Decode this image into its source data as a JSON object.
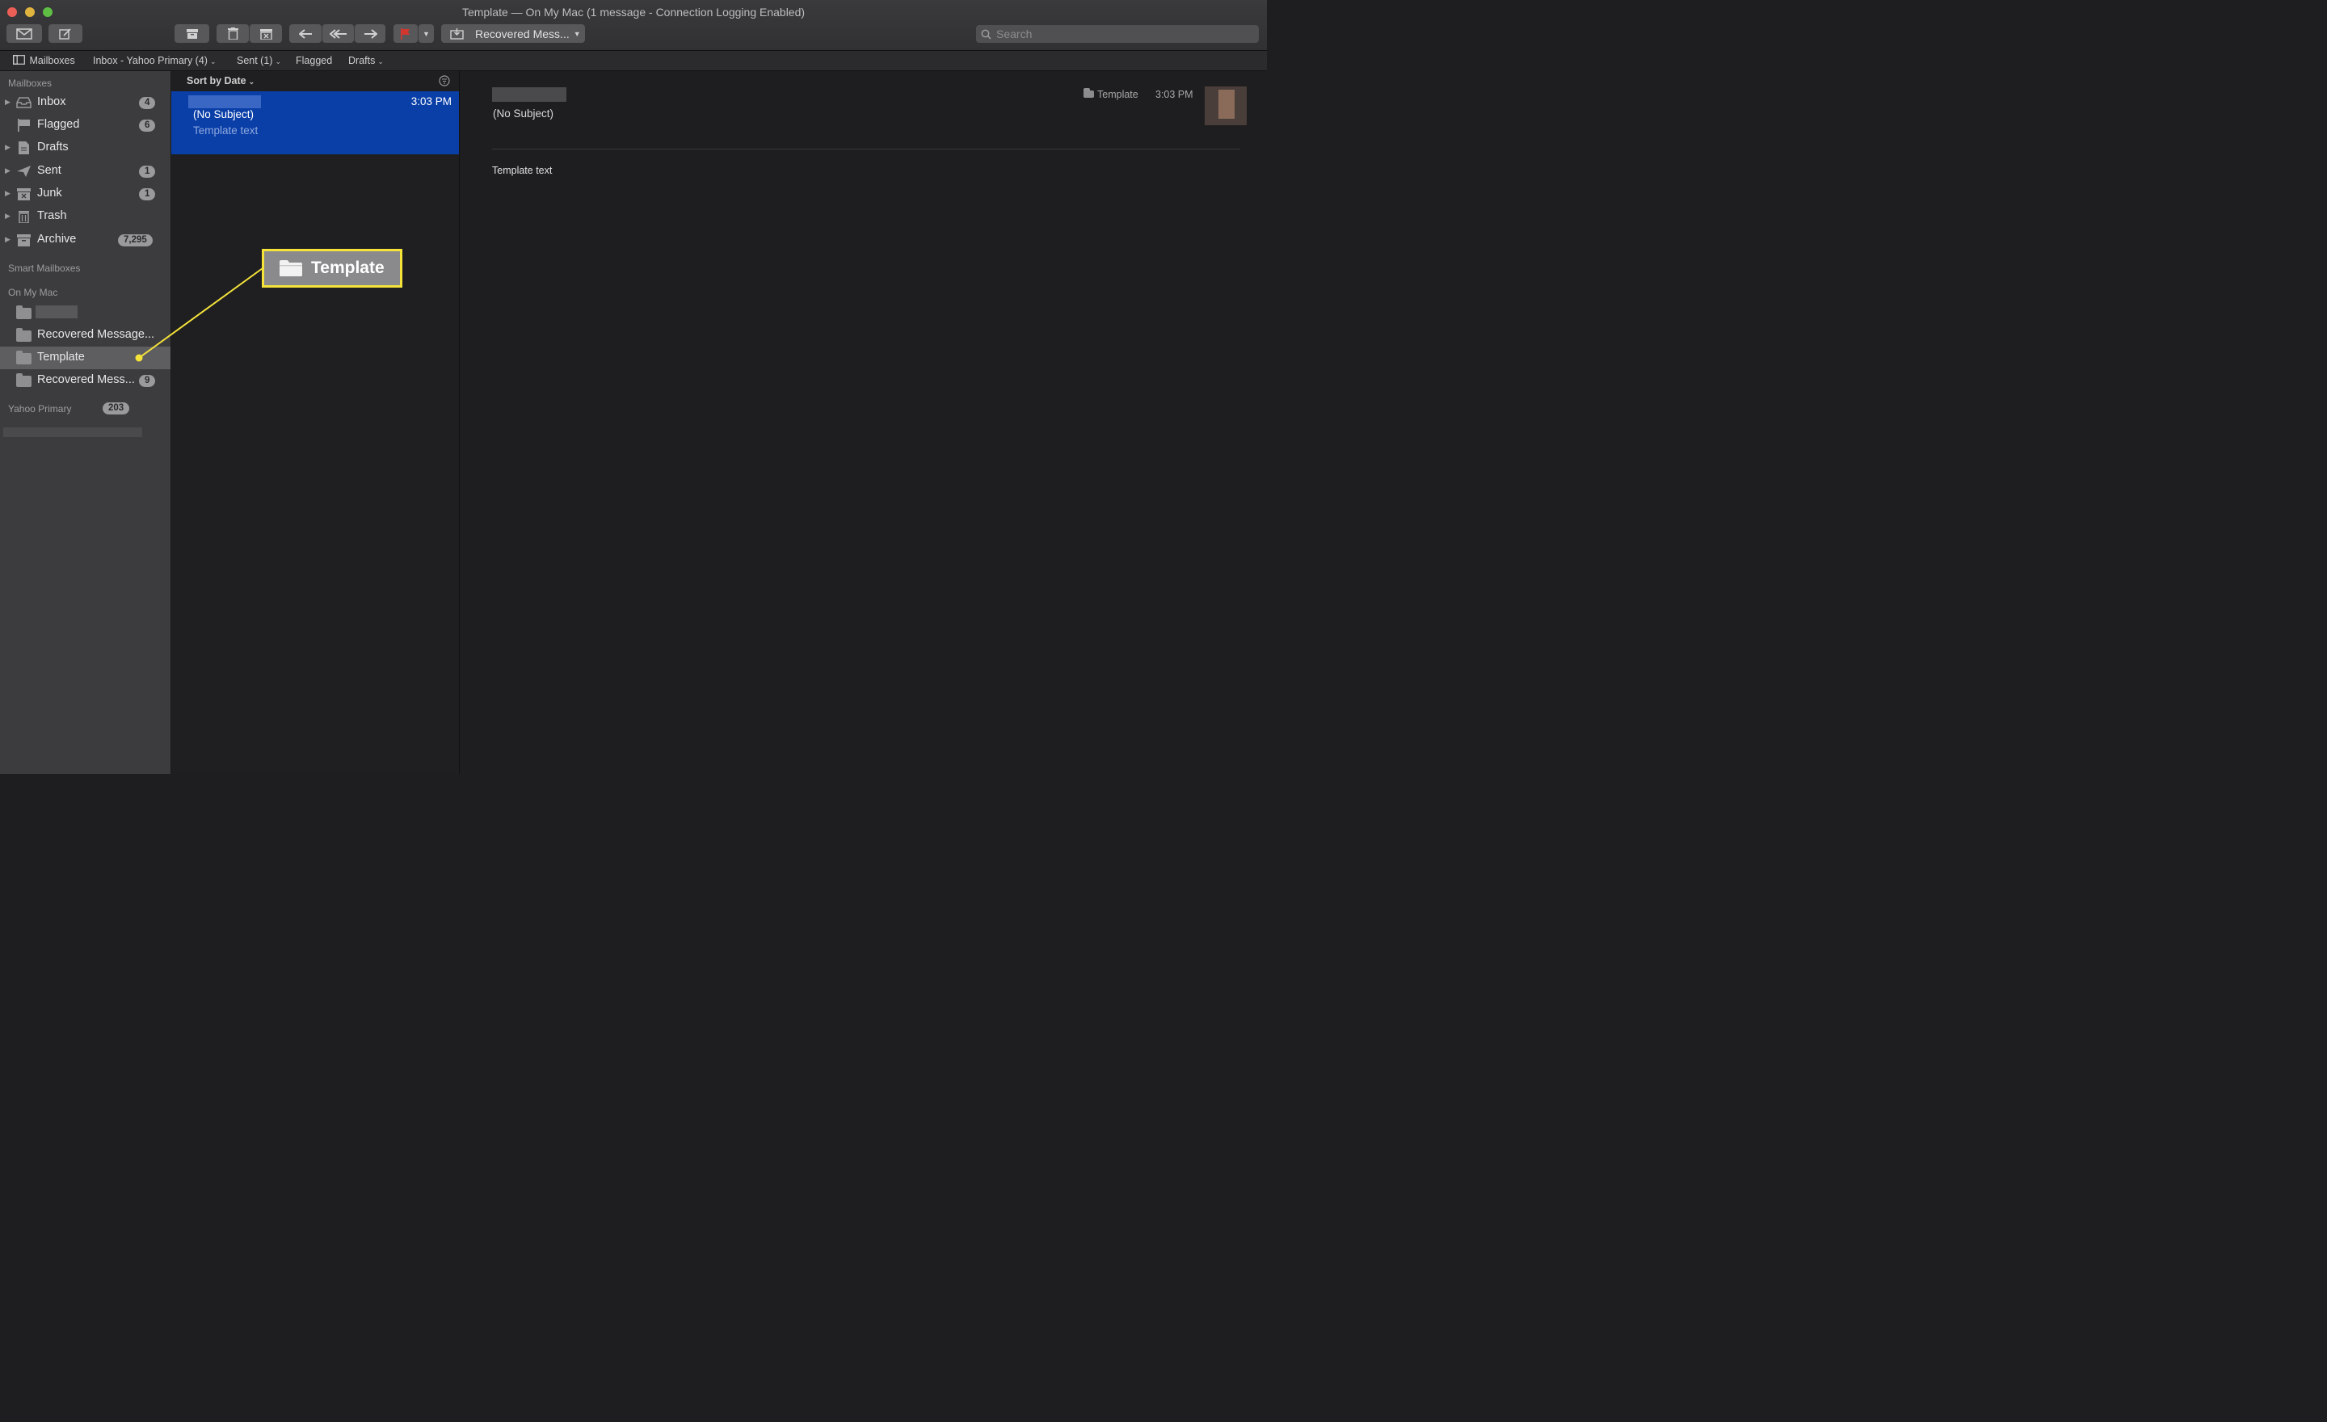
{
  "window": {
    "title": "Template — On My Mac (1 message - Connection Logging Enabled)"
  },
  "toolbar": {
    "move_to_label": "Recovered Mess...",
    "search_placeholder": "Search"
  },
  "favorites_bar": {
    "mailboxes": "Mailboxes",
    "inbox": "Inbox - Yahoo Primary (4)",
    "sent": "Sent (1)",
    "flagged": "Flagged",
    "drafts": "Drafts"
  },
  "sidebar": {
    "mailboxes_header": "Mailboxes",
    "mailboxes": [
      {
        "label": "Inbox",
        "badge": "4",
        "icon": "inbox-icon"
      },
      {
        "label": "Flagged",
        "badge": "6",
        "icon": "flag-icon"
      },
      {
        "label": "Drafts",
        "badge": "",
        "icon": "drafts-icon"
      },
      {
        "label": "Sent",
        "badge": "1",
        "icon": "sent-icon"
      },
      {
        "label": "Junk",
        "badge": "1",
        "icon": "junk-icon"
      },
      {
        "label": "Trash",
        "badge": "",
        "icon": "trash-icon"
      },
      {
        "label": "Archive",
        "badge": "7,295",
        "icon": "archive-icon"
      }
    ],
    "smart_header": "Smart Mailboxes",
    "on_my_mac_header": "On My Mac",
    "on_my_mac": [
      {
        "label": "Recovered Message...",
        "badge": ""
      },
      {
        "label": "Template",
        "badge": ""
      },
      {
        "label": "Recovered Mess...",
        "badge": "9"
      }
    ],
    "yahoo_header": "Yahoo Primary",
    "yahoo_badge": "203"
  },
  "message_list": {
    "sort_label": "Sort by Date",
    "messages": [
      {
        "subject": "(No Subject)",
        "preview": "Template text",
        "time": "3:03 PM"
      }
    ]
  },
  "preview": {
    "subject": "(No Subject)",
    "mailbox": "Template",
    "time": "3:03 PM",
    "body": "Template text"
  },
  "annotation": {
    "label": "Template"
  },
  "colors": {
    "selection_blue": "#0a3fa8",
    "callout_border": "#f5e33a",
    "flag_red": "#d2362f"
  }
}
